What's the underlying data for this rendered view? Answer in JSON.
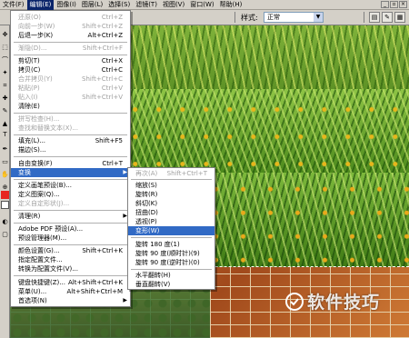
{
  "menubar": {
    "items": [
      {
        "label": "文件(F)"
      },
      {
        "label": "编辑(E)"
      },
      {
        "label": "图像(I)"
      },
      {
        "label": "图层(L)"
      },
      {
        "label": "选择(S)"
      },
      {
        "label": "滤镜(T)"
      },
      {
        "label": "视图(V)"
      },
      {
        "label": "窗口(W)"
      },
      {
        "label": "帮助(H)"
      }
    ]
  },
  "options_bar": {
    "style_label": "样式:",
    "style_value": "正常"
  },
  "edit_menu": {
    "items": [
      {
        "label": "还原(O)",
        "shortcut": "Ctrl+Z"
      },
      {
        "label": "向前一步(W)",
        "shortcut": "Shift+Ctrl+Z"
      },
      {
        "label": "后退一步(K)",
        "shortcut": "Alt+Ctrl+Z"
      },
      {
        "label": "渐隐(D)...",
        "shortcut": "Shift+Ctrl+F"
      },
      {
        "label": "剪切(T)",
        "shortcut": "Ctrl+X"
      },
      {
        "label": "拷贝(C)",
        "shortcut": "Ctrl+C"
      },
      {
        "label": "合并拷贝(Y)",
        "shortcut": "Shift+Ctrl+C"
      },
      {
        "label": "粘贴(P)",
        "shortcut": "Ctrl+V"
      },
      {
        "label": "贴入(I)",
        "shortcut": "Shift+Ctrl+V"
      },
      {
        "label": "清除(E)",
        "shortcut": ""
      },
      {
        "label": "拼写检查(H)...",
        "shortcut": ""
      },
      {
        "label": "查找和替换文本(X)...",
        "shortcut": ""
      },
      {
        "label": "填充(L)...",
        "shortcut": "Shift+F5"
      },
      {
        "label": "描边(S)...",
        "shortcut": ""
      },
      {
        "label": "自由变换(F)",
        "shortcut": "Ctrl+T"
      },
      {
        "label": "变换",
        "shortcut": ""
      },
      {
        "label": "定义画笔预设(B)...",
        "shortcut": ""
      },
      {
        "label": "定义图案(Q)...",
        "shortcut": ""
      },
      {
        "label": "定义自定形状(J)...",
        "shortcut": ""
      },
      {
        "label": "清理(R)",
        "shortcut": ""
      },
      {
        "label": "Adobe PDF 预设(A)...",
        "shortcut": ""
      },
      {
        "label": "预设管理器(M)...",
        "shortcut": ""
      },
      {
        "label": "颜色设置(G)...",
        "shortcut": "Shift+Ctrl+K"
      },
      {
        "label": "指定配置文件...",
        "shortcut": ""
      },
      {
        "label": "转换为配置文件(V)...",
        "shortcut": ""
      },
      {
        "label": "键盘快捷键(Z)...",
        "shortcut": "Alt+Shift+Ctrl+K"
      },
      {
        "label": "菜单(U)...",
        "shortcut": "Alt+Shift+Ctrl+M"
      },
      {
        "label": "首选项(N)",
        "shortcut": ""
      }
    ]
  },
  "transform_menu": {
    "items": [
      {
        "label": "再次(A)",
        "shortcut": "Shift+Ctrl+T"
      },
      {
        "label": "缩放(S)",
        "shortcut": ""
      },
      {
        "label": "旋转(R)",
        "shortcut": ""
      },
      {
        "label": "斜切(K)",
        "shortcut": ""
      },
      {
        "label": "扭曲(D)",
        "shortcut": ""
      },
      {
        "label": "透视(P)",
        "shortcut": ""
      },
      {
        "label": "变形(W)",
        "shortcut": ""
      },
      {
        "label": "旋转 180 度(1)",
        "shortcut": ""
      },
      {
        "label": "旋转 90 度(顺时针)(9)",
        "shortcut": ""
      },
      {
        "label": "旋转 90 度(逆时针)(0)",
        "shortcut": ""
      },
      {
        "label": "水平翻转(H)",
        "shortcut": ""
      },
      {
        "label": "垂直翻转(V)",
        "shortcut": ""
      }
    ]
  },
  "toolbox": {
    "text_tool_glyph": "T",
    "foreground_color": "#e8251f",
    "background_color": "#ffffff"
  },
  "watermark": {
    "text": "软件技巧",
    "logo_color": "#ffffff"
  }
}
